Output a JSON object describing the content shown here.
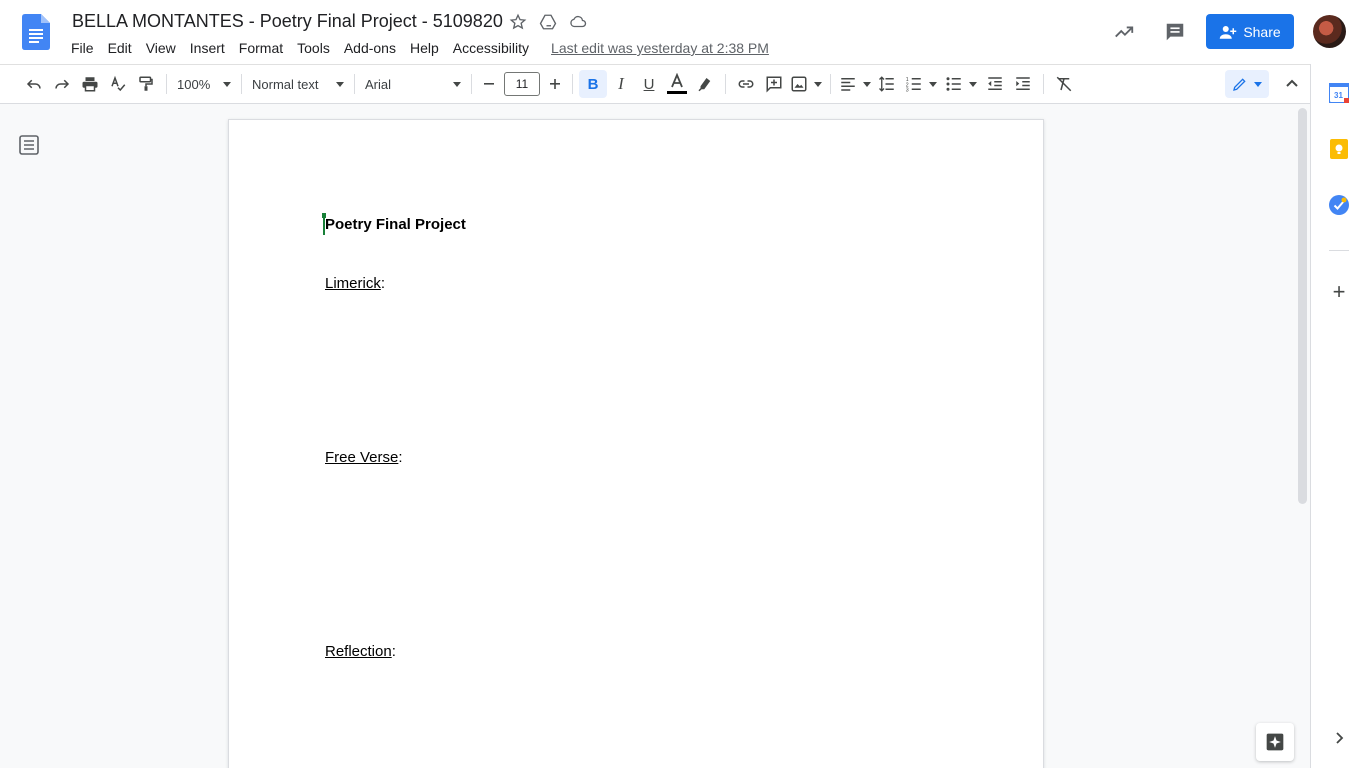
{
  "app": {
    "title": "BELLA MONTANTES - Poetry Final Project - 5109820",
    "last_edit": "Last edit was yesterday at 2:38 PM",
    "share_label": "Share"
  },
  "menu": [
    "File",
    "Edit",
    "View",
    "Insert",
    "Format",
    "Tools",
    "Add-ons",
    "Help",
    "Accessibility"
  ],
  "toolbar": {
    "zoom": "100%",
    "style": "Normal text",
    "font": "Arial",
    "font_size": "11",
    "bold_active": true
  },
  "document": {
    "title": "Poetry Final Project",
    "sections": [
      {
        "label": "Limerick",
        "suffix": ":"
      },
      {
        "label": "Free Verse",
        "suffix": ":"
      },
      {
        "label": "Reflection",
        "suffix": ":"
      }
    ]
  },
  "side_panel": {
    "calendar_date": "31"
  },
  "colors": {
    "accent": "#1a73e8",
    "docs_blue": "#4285f4",
    "cursor_green": "#188038",
    "keep_yellow": "#fbbc04"
  }
}
